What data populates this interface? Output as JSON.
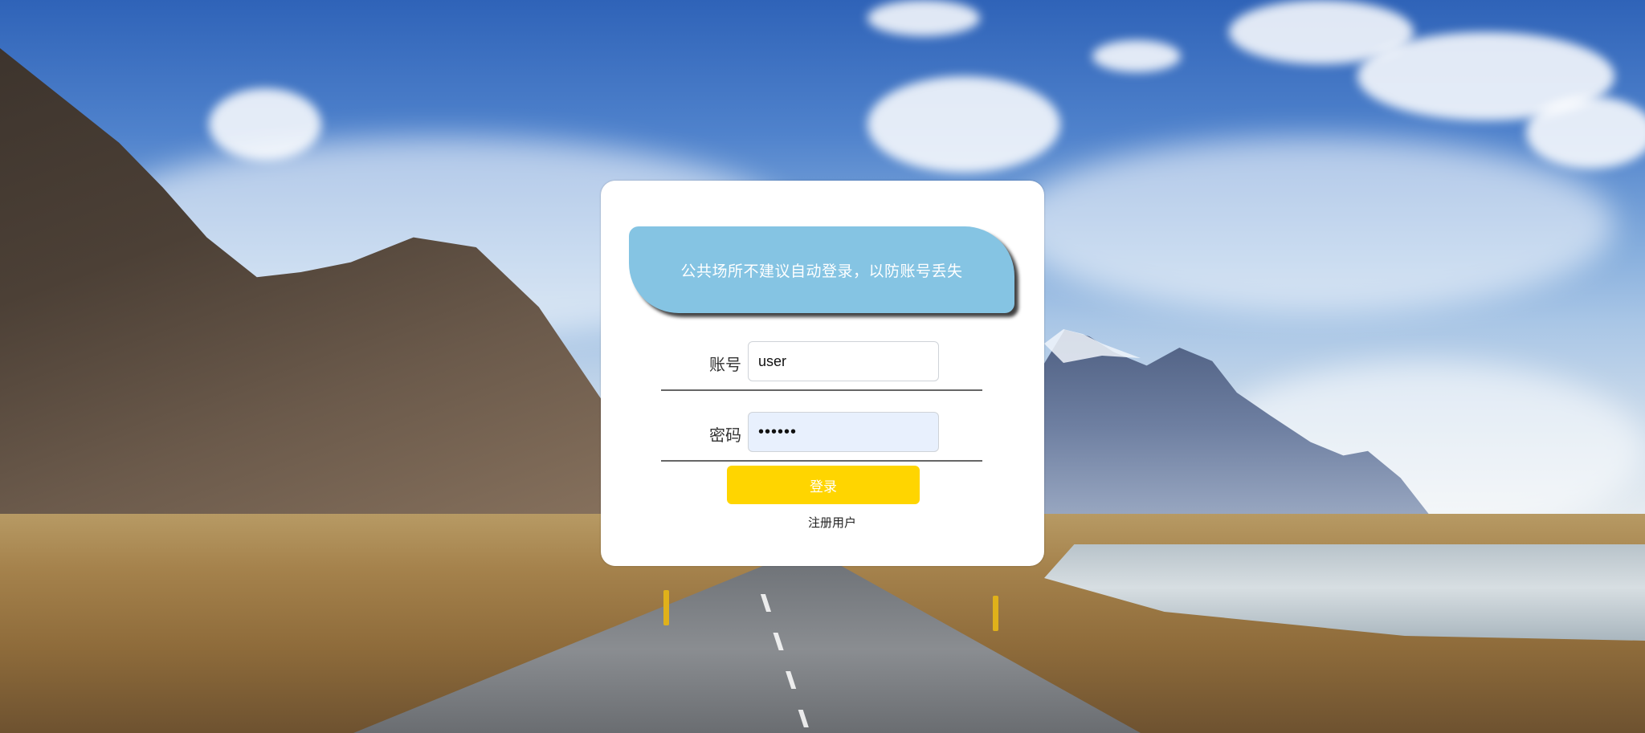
{
  "notice": {
    "text": "公共场所不建议自动登录，以防账号丢失"
  },
  "form": {
    "account_label": "账号",
    "account_value": "user",
    "password_label": "密码",
    "password_value": "••••••",
    "login_button_label": "登录",
    "register_link_text": "注册用户"
  },
  "colors": {
    "notice_background": "#85c4e3",
    "login_button": "#ffd500",
    "card_background": "#ffffff",
    "password_field_background": "#e8f0fd"
  }
}
